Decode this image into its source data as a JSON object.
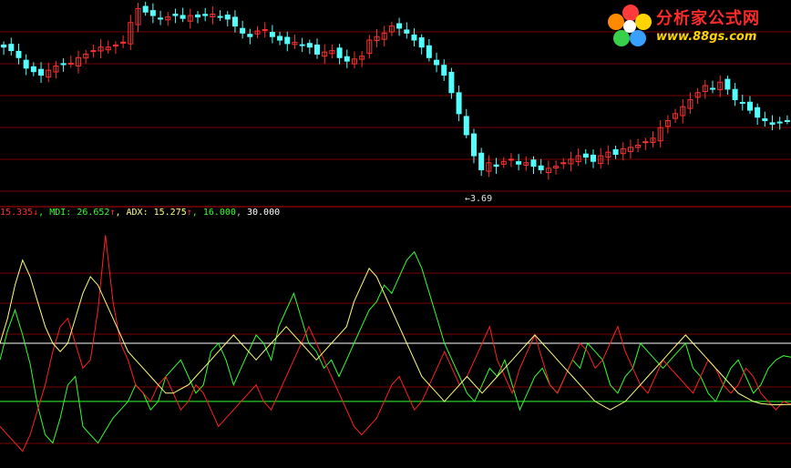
{
  "logo": {
    "name": "分析家公式网",
    "url": "www.88gs.com"
  },
  "upper": {
    "low_marker": "←3.69"
  },
  "legend": {
    "pdi_value": "15.335",
    "pdi_arrow": "↓",
    "mdi_label": "MDI: ",
    "mdi_value": "26.652",
    "mdi_arrow": "↑",
    "adx_label": "ADX: ",
    "adx_value": "15.275",
    "adx_arrow": "↑",
    "level_low": "16.000",
    "level_high": "30.000"
  },
  "colors": {
    "up": "#ff3030",
    "down": "#54ffff",
    "pdi": "#ff2020",
    "mdi": "#30ff30",
    "adx": "#ffff80",
    "level_high": "#ffffff",
    "level_low": "#30ff30",
    "grid": "#7a0000"
  },
  "chart_data": [
    {
      "type": "candlestick",
      "price_low_label": "3.69",
      "closes": [
        5.85,
        5.8,
        5.7,
        5.55,
        5.5,
        5.45,
        5.52,
        5.58,
        5.6,
        5.62,
        5.7,
        5.75,
        5.8,
        5.85,
        5.85,
        5.88,
        5.92,
        6.2,
        6.4,
        6.35,
        6.3,
        6.25,
        6.28,
        6.3,
        6.26,
        6.3,
        6.28,
        6.3,
        6.32,
        6.28,
        6.25,
        6.15,
        6.05,
        6.0,
        6.08,
        6.1,
        6.0,
        5.95,
        5.9,
        5.92,
        5.88,
        5.85,
        5.75,
        5.78,
        5.8,
        5.7,
        5.65,
        5.68,
        5.72,
        5.95,
        6.0,
        6.05,
        6.15,
        6.12,
        6.05,
        5.95,
        5.85,
        5.7,
        5.6,
        5.45,
        5.2,
        4.9,
        4.6,
        4.3,
        4.1,
        4.2,
        4.15,
        4.22,
        4.25,
        4.18,
        4.2,
        4.15,
        4.1,
        4.12,
        4.15,
        4.2,
        4.25,
        4.3,
        4.28,
        4.22,
        4.3,
        4.35,
        4.32,
        4.4,
        4.42,
        4.45,
        4.5,
        4.55,
        4.7,
        4.8,
        4.9,
        5.0,
        5.1,
        5.2,
        5.3,
        5.25,
        5.35,
        5.25,
        5.1,
        5.05,
        4.95,
        4.85,
        4.8,
        4.75,
        4.78,
        4.8
      ],
      "high": 6.47,
      "low": 3.69
    },
    {
      "type": "line",
      "title": "DMI",
      "ylim": [
        0,
        60
      ],
      "levels": [
        16,
        30
      ],
      "series": [
        {
          "name": "MDI",
          "values": [
            26,
            33,
            38,
            32,
            25,
            15,
            8,
            6,
            12,
            20,
            22,
            10,
            8,
            6,
            9,
            12,
            14,
            16,
            20,
            18,
            14,
            16,
            22,
            24,
            26,
            22,
            18,
            20,
            28,
            30,
            26,
            20,
            24,
            28,
            32,
            30,
            26,
            34,
            38,
            42,
            36,
            30,
            28,
            24,
            26,
            22,
            26,
            30,
            34,
            38,
            40,
            44,
            42,
            46,
            50,
            52,
            48,
            42,
            36,
            30,
            26,
            22,
            18,
            16,
            20,
            24,
            22,
            26,
            20,
            14,
            18,
            22,
            24,
            20,
            18,
            22,
            26,
            24,
            30,
            28,
            26,
            20,
            18,
            22,
            24,
            30,
            28,
            26,
            24,
            26,
            28,
            30,
            24,
            22,
            18,
            16,
            20,
            24,
            26,
            22,
            18,
            20,
            24,
            26,
            27,
            26.652
          ]
        },
        {
          "name": "PDI",
          "values": [
            10,
            8,
            6,
            4,
            8,
            14,
            20,
            28,
            34,
            36,
            30,
            24,
            26,
            38,
            56,
            40,
            30,
            26,
            20,
            18,
            16,
            20,
            22,
            18,
            14,
            16,
            20,
            18,
            14,
            10,
            12,
            14,
            16,
            18,
            20,
            16,
            14,
            18,
            22,
            26,
            30,
            34,
            30,
            26,
            22,
            18,
            14,
            10,
            8,
            10,
            12,
            16,
            20,
            22,
            18,
            14,
            16,
            20,
            24,
            28,
            24,
            20,
            22,
            26,
            30,
            34,
            26,
            22,
            18,
            24,
            28,
            32,
            26,
            20,
            18,
            22,
            26,
            30,
            28,
            24,
            26,
            30,
            34,
            28,
            24,
            20,
            18,
            22,
            26,
            24,
            22,
            20,
            18,
            22,
            26,
            24,
            20,
            18,
            20,
            24,
            22,
            18,
            16,
            14,
            16,
            15.335
          ]
        },
        {
          "name": "ADX",
          "values": [
            30,
            36,
            44,
            50,
            46,
            40,
            34,
            30,
            28,
            30,
            36,
            42,
            46,
            44,
            40,
            36,
            32,
            28,
            26,
            24,
            22,
            20,
            18,
            18,
            19,
            20,
            22,
            24,
            26,
            28,
            30,
            32,
            30,
            28,
            26,
            28,
            30,
            32,
            34,
            32,
            30,
            28,
            26,
            28,
            30,
            32,
            34,
            40,
            44,
            48,
            46,
            42,
            38,
            34,
            30,
            26,
            22,
            20,
            18,
            16,
            18,
            20,
            22,
            20,
            18,
            20,
            22,
            24,
            26,
            28,
            30,
            32,
            30,
            28,
            26,
            24,
            22,
            20,
            18,
            16,
            15,
            14,
            15,
            16,
            18,
            20,
            22,
            24,
            26,
            28,
            30,
            32,
            30,
            28,
            26,
            24,
            22,
            20,
            18,
            17,
            16,
            15.5,
            15.3,
            15.2,
            15.25,
            15.275
          ]
        }
      ]
    }
  ]
}
